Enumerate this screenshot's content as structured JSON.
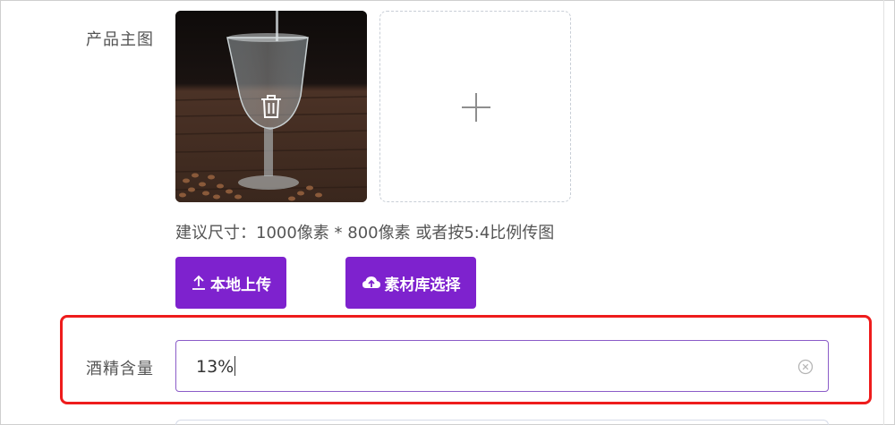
{
  "form": {
    "main_image_label": "产品主图",
    "size_hint": "建议尺寸：1000像素 * 800像素 或者按5:4比例传图",
    "upload_button_label": "本地上传",
    "library_button_label": "素材库选择",
    "alcohol_label": "酒精含量",
    "alcohol_value": "13%"
  },
  "icons": {
    "delete": "trash-icon",
    "add": "plus-icon",
    "upload": "upload-icon",
    "library": "cloud-upload-icon",
    "clear": "clear-circle-icon"
  },
  "colors": {
    "primary_button": "#7e22ce",
    "input_focus_border": "#8b5cc8",
    "highlight_box": "#ee1c1c"
  }
}
